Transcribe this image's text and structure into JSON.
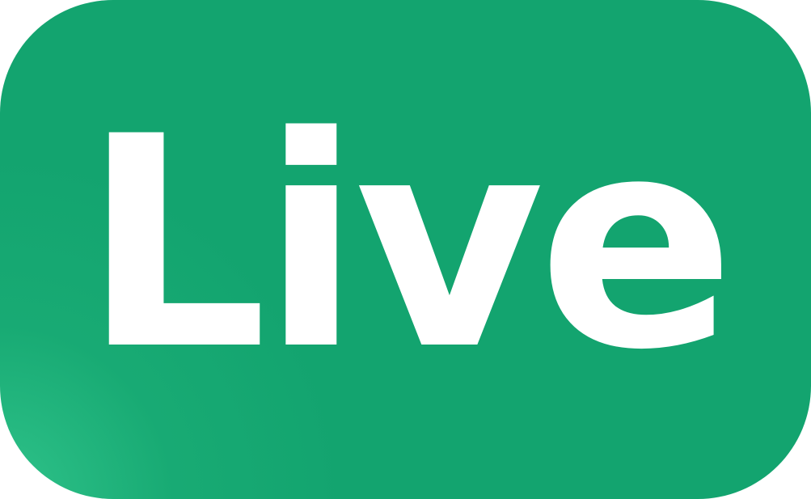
{
  "badge": {
    "label": "Live",
    "background_color": "#13A46F",
    "text_color": "#FFFFFF"
  }
}
